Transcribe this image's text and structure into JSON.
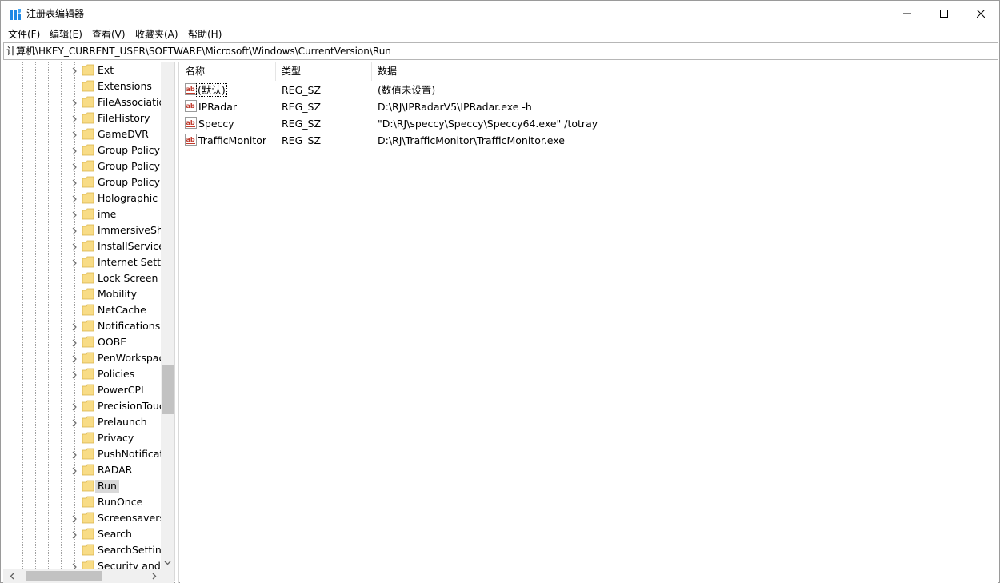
{
  "window": {
    "title": "注册表编辑器"
  },
  "menu": [
    "文件(F)",
    "编辑(E)",
    "查看(V)",
    "收藏夹(A)",
    "帮助(H)"
  ],
  "address": "计算机\\HKEY_CURRENT_USER\\SOFTWARE\\Microsoft\\Windows\\CurrentVersion\\Run",
  "tree": {
    "items": [
      {
        "label": "Ext",
        "expandable": true
      },
      {
        "label": "Extensions",
        "expandable": false
      },
      {
        "label": "FileAssociatio",
        "expandable": true
      },
      {
        "label": "FileHistory",
        "expandable": true
      },
      {
        "label": "GameDVR",
        "expandable": true
      },
      {
        "label": "Group Policy",
        "expandable": true
      },
      {
        "label": "Group Policy",
        "expandable": true
      },
      {
        "label": "Group Policy (",
        "expandable": true
      },
      {
        "label": "Holographic",
        "expandable": true
      },
      {
        "label": "ime",
        "expandable": true
      },
      {
        "label": "ImmersiveShe",
        "expandable": true
      },
      {
        "label": "InstallService",
        "expandable": true
      },
      {
        "label": "Internet Settir",
        "expandable": true
      },
      {
        "label": "Lock Screen",
        "expandable": false
      },
      {
        "label": "Mobility",
        "expandable": false
      },
      {
        "label": "NetCache",
        "expandable": false
      },
      {
        "label": "Notifications",
        "expandable": true
      },
      {
        "label": "OOBE",
        "expandable": true
      },
      {
        "label": "PenWorkspac",
        "expandable": true
      },
      {
        "label": "Policies",
        "expandable": true
      },
      {
        "label": "PowerCPL",
        "expandable": false
      },
      {
        "label": "PrecisionTouc",
        "expandable": true
      },
      {
        "label": "Prelaunch",
        "expandable": true
      },
      {
        "label": "Privacy",
        "expandable": false
      },
      {
        "label": "PushNotificati",
        "expandable": true
      },
      {
        "label": "RADAR",
        "expandable": true
      },
      {
        "label": "Run",
        "expandable": false,
        "selected": true
      },
      {
        "label": "RunOnce",
        "expandable": false
      },
      {
        "label": "Screensavers",
        "expandable": true
      },
      {
        "label": "Search",
        "expandable": true
      },
      {
        "label": "SearchSetting",
        "expandable": false
      },
      {
        "label": "Security and M",
        "expandable": true
      }
    ]
  },
  "list": {
    "columns": [
      "名称",
      "类型",
      "数据"
    ],
    "rows": [
      {
        "name": "(默认)",
        "type": "REG_SZ",
        "data": "(数值未设置)"
      },
      {
        "name": "IPRadar",
        "type": "REG_SZ",
        "data": "D:\\RJ\\IPRadarV5\\IPRadar.exe -h"
      },
      {
        "name": "Speccy",
        "type": "REG_SZ",
        "data": "\"D:\\RJ\\speccy\\Speccy\\Speccy64.exe\" /totray"
      },
      {
        "name": "TrafficMonitor",
        "type": "REG_SZ",
        "data": "D:\\RJ\\TrafficMonitor\\TrafficMonitor.exe"
      }
    ]
  },
  "icons": {
    "app": "regedit-icon",
    "folder": "folder-icon",
    "value": "string-value-icon",
    "folder_color": "#f5d97b",
    "value_color": "#c0392b"
  }
}
